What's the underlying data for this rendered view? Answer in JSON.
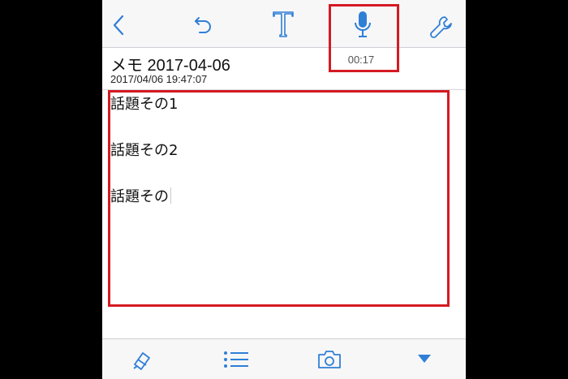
{
  "toolbar": {
    "back_icon": "chevron-left-icon",
    "undo_icon": "undo-icon",
    "text_format_icon": "text-format-icon",
    "mic_icon": "microphone-icon",
    "settings_icon": "wrench-icon",
    "recording_time": "00:17"
  },
  "note": {
    "title": "メモ 2017-04-06",
    "date": "2017/04/06 19:47:07",
    "lines": [
      "話題その1",
      "話題その2",
      "話題その"
    ]
  },
  "bottom_toolbar": {
    "icons": [
      "highlighter-icon",
      "list-icon",
      "camera-icon",
      "dropdown-arrow-icon"
    ]
  },
  "colors": {
    "accent": "#2f7fd6",
    "highlight_box": "#d41a22",
    "background": "#000000"
  }
}
